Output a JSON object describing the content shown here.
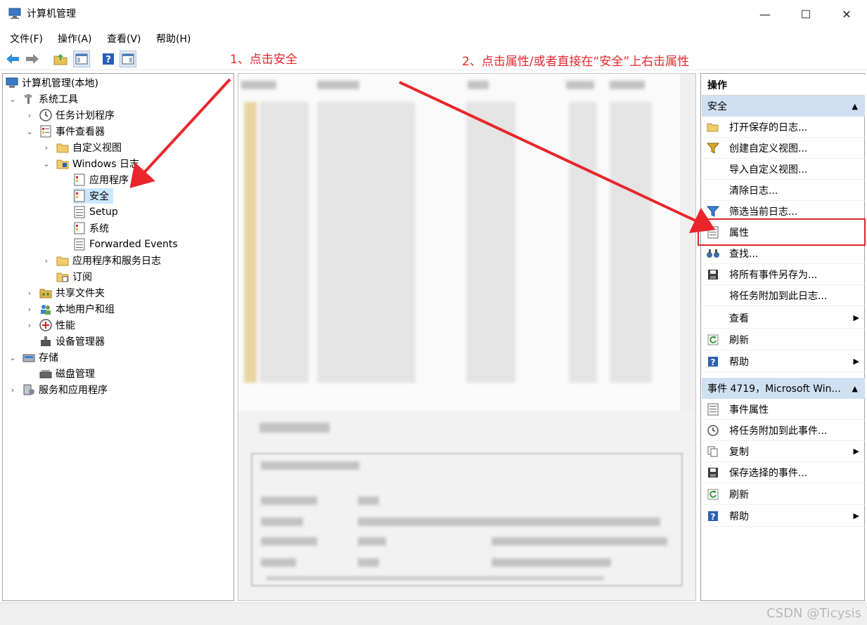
{
  "window": {
    "title": "计算机管理",
    "caption_buttons": {
      "minimize": "—",
      "maximize": "☐",
      "close": "✕"
    }
  },
  "menu": [
    "文件(F)",
    "操作(A)",
    "查看(V)",
    "帮助(H)"
  ],
  "toolbar": {
    "icons": [
      "back-arrow-icon",
      "forward-arrow-icon",
      "up-folder-icon",
      "show-hide-tree-icon",
      "help-icon",
      "show-hide-action-pane-icon"
    ]
  },
  "tree": {
    "root": "计算机管理(本地)",
    "system_tools": "系统工具",
    "task_scheduler": "任务计划程序",
    "event_viewer": "事件查看器",
    "custom_views": "自定义视图",
    "windows_logs": "Windows 日志",
    "application": "应用程序",
    "security": "安全",
    "setup": "Setup",
    "system": "系统",
    "forwarded_events": "Forwarded Events",
    "app_service_logs": "应用程序和服务日志",
    "subscriptions": "订阅",
    "shared_folders": "共享文件夹",
    "local_users": "本地用户和组",
    "performance": "性能",
    "device_manager": "设备管理器",
    "storage": "存储",
    "disk_management": "磁盘管理",
    "services_apps": "服务和应用程序"
  },
  "actions": {
    "title": "操作",
    "section1": "安全",
    "items1": [
      "打开保存的日志...",
      "创建自定义视图...",
      "导入自定义视图...",
      "清除日志...",
      "筛选当前日志...",
      "属性",
      "查找...",
      "将所有事件另存为...",
      "将任务附加到此日志...",
      "查看",
      "刷新",
      "帮助"
    ],
    "section2": "事件 4719，Microsoft Win...",
    "items2": [
      "事件属性",
      "将任务附加到此事件...",
      "复制",
      "保存选择的事件...",
      "刷新",
      "帮助"
    ]
  },
  "annotations": {
    "step1": "1、点击安全",
    "step2": "2、点击属性/或者直接在“安全”上右击属性"
  },
  "watermark": "CSDN @Ticysis",
  "colors": {
    "annotation_red": "#e8262c",
    "selection_blue": "#cce8ff",
    "section_header": "#cfe0f2"
  }
}
